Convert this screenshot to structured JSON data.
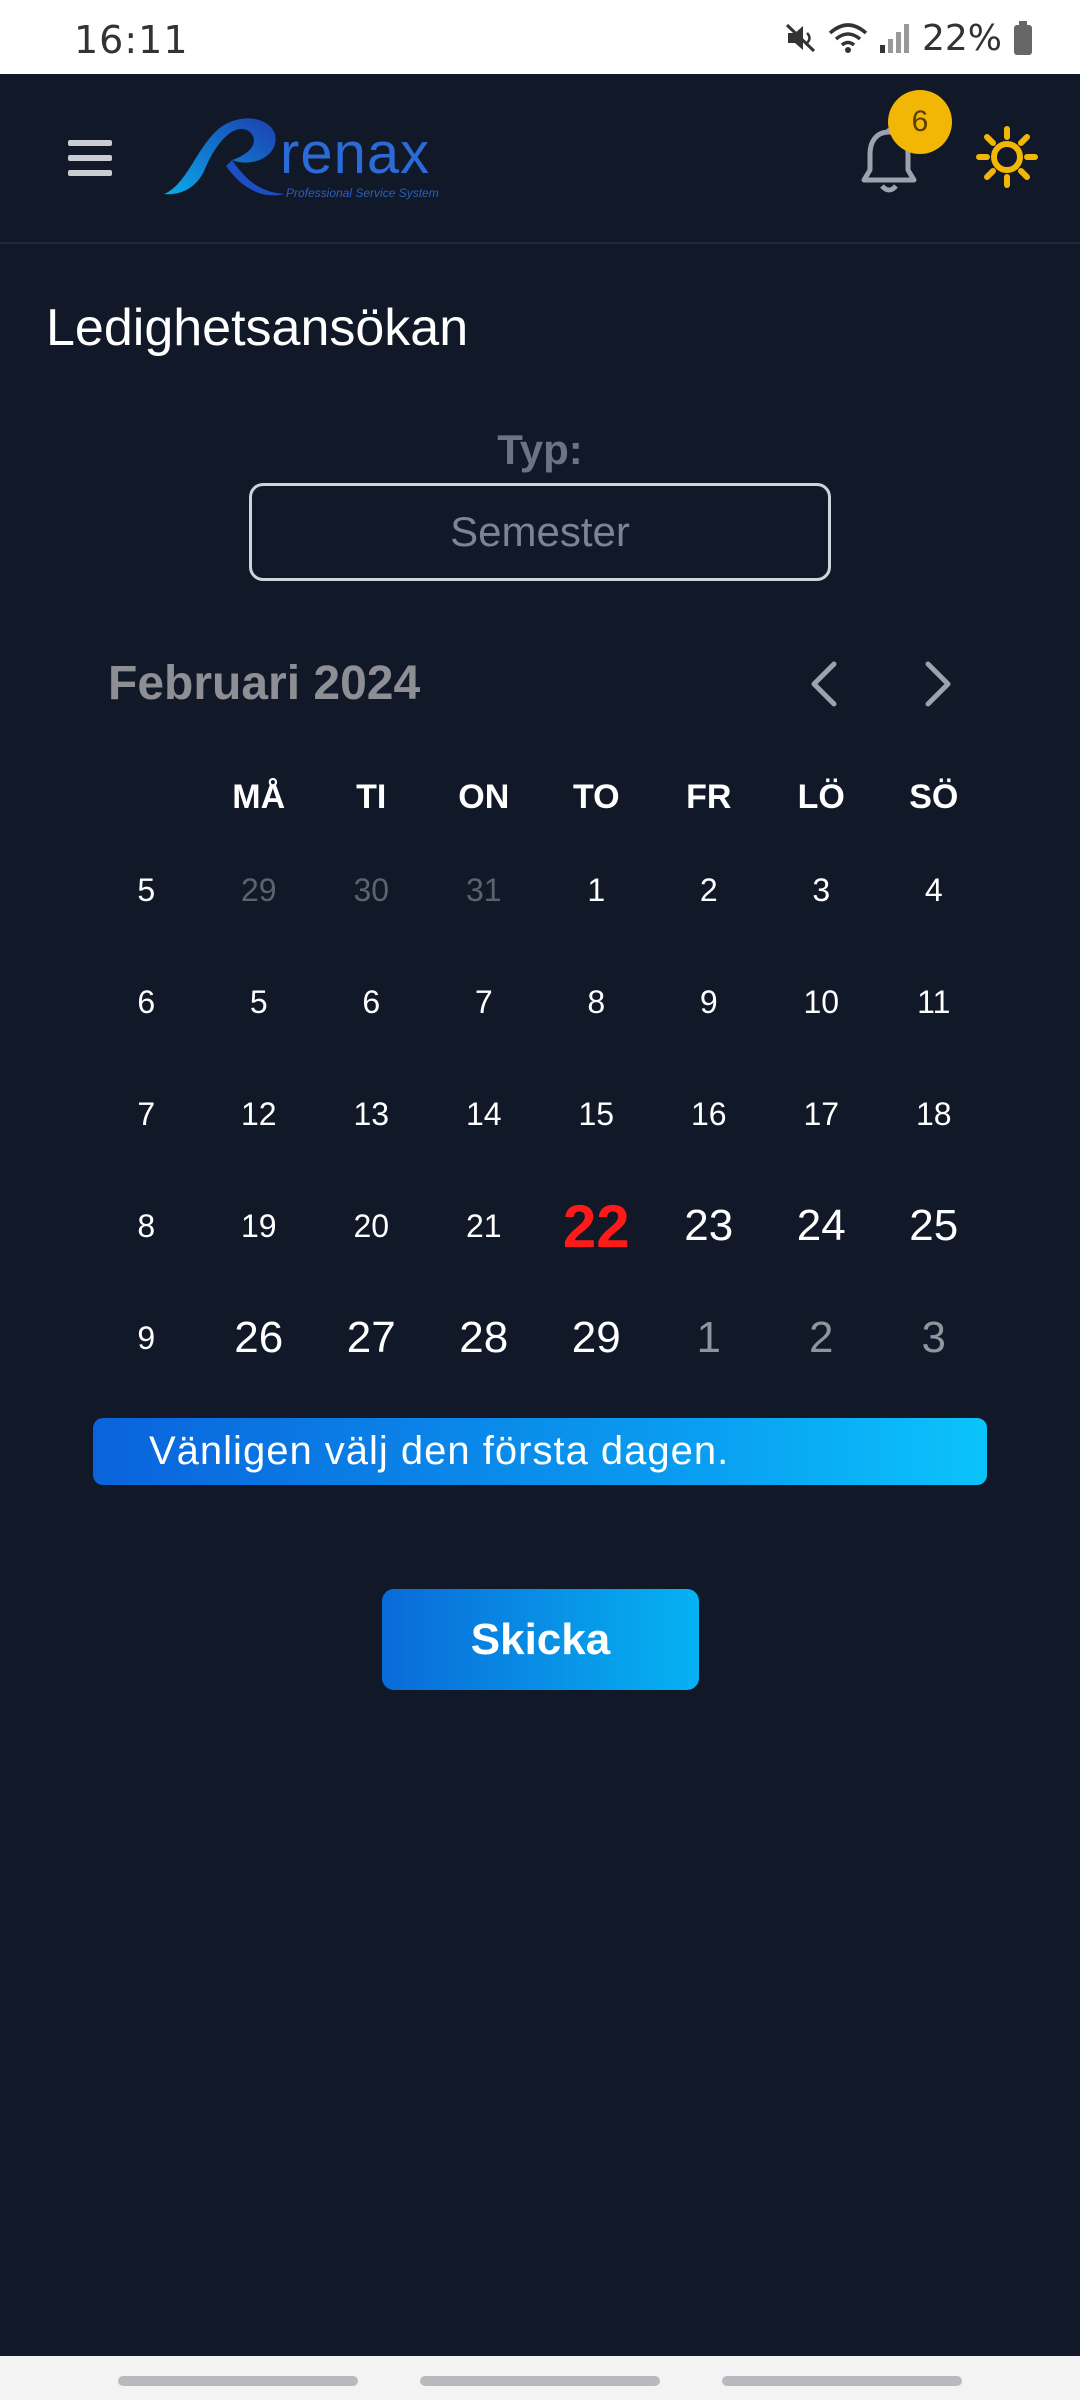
{
  "status_bar": {
    "time": "16:11",
    "battery_percent": "22%",
    "icons": [
      "mute-icon",
      "wifi-icon",
      "signal-icon",
      "battery-icon"
    ]
  },
  "header": {
    "logo_text": "renax",
    "logo_tagline": "Professional Service System",
    "notification_count": "6",
    "colors": {
      "badge": "#f2b705",
      "sun": "#f2b705"
    }
  },
  "page": {
    "title": "Ledighetsansökan",
    "type_label": "Typ:",
    "type_value": "Semester"
  },
  "calendar": {
    "month_title": "Februari 2024",
    "weekdays": [
      "MÅ",
      "TI",
      "ON",
      "TO",
      "FR",
      "LÖ",
      "SÖ"
    ],
    "weeks": [
      {
        "week": "5",
        "days": [
          "29",
          "30",
          "31",
          "1",
          "2",
          "3",
          "4"
        ]
      },
      {
        "week": "6",
        "days": [
          "5",
          "6",
          "7",
          "8",
          "9",
          "10",
          "11"
        ]
      },
      {
        "week": "7",
        "days": [
          "12",
          "13",
          "14",
          "15",
          "16",
          "17",
          "18"
        ]
      },
      {
        "week": "8",
        "days": [
          "19",
          "20",
          "21",
          "22",
          "23",
          "24",
          "25"
        ]
      },
      {
        "week": "9",
        "days": [
          "26",
          "27",
          "28",
          "29",
          "1",
          "2",
          "3"
        ]
      }
    ],
    "today": "22",
    "today_color": "#ff1a1a"
  },
  "info_message": "Vänligen välj den första dagen.",
  "submit_label": "Skicka"
}
